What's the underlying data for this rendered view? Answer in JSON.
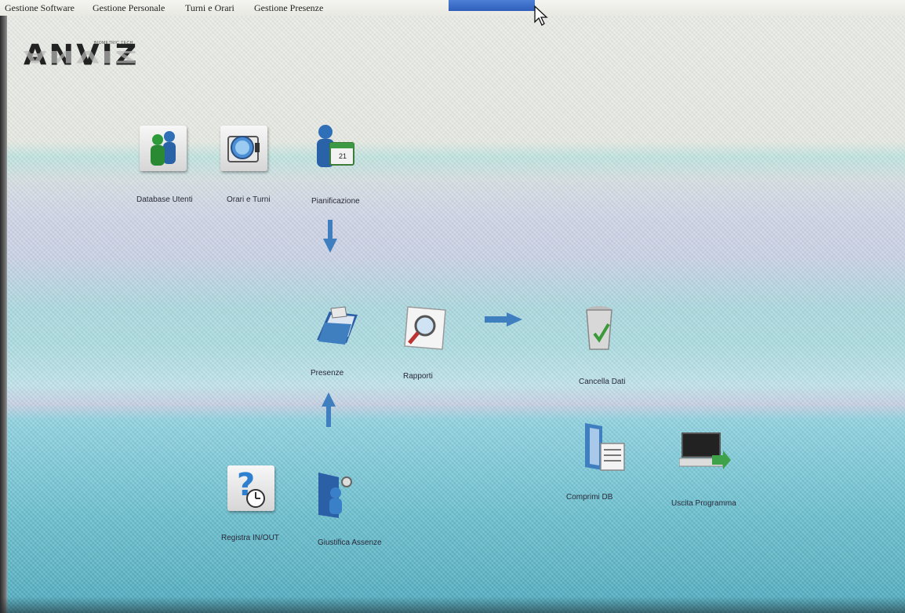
{
  "menu": {
    "items": [
      {
        "label": "Gestione Software"
      },
      {
        "label": "Gestione Personale"
      },
      {
        "label": "Turni e Orari"
      },
      {
        "label": "Gestione Presenze"
      }
    ]
  },
  "logo": {
    "text": "ANVIZ",
    "tagline": "BIOMETRIC TECH"
  },
  "icons": {
    "database_utenti": {
      "label": "Database Utenti",
      "icon": "users-icon"
    },
    "orari_turni": {
      "label": "Orari e Turni",
      "icon": "clock-icon"
    },
    "pianificazione": {
      "label": "Pianificazione",
      "icon": "calendar-user-icon",
      "calendar_day": "21"
    },
    "presenze": {
      "label": "Presenze",
      "icon": "folder-icon"
    },
    "rapporti": {
      "label": "Rapporti",
      "icon": "report-magnifier-icon"
    },
    "cancella_dati": {
      "label": "Cancella Dati",
      "icon": "trash-icon"
    },
    "comprimi_db": {
      "label": "Comprimi DB",
      "icon": "compress-db-icon"
    },
    "uscita_programma": {
      "label": "Uscita Programma",
      "icon": "exit-computer-icon"
    },
    "registra_inout": {
      "label": "Registra IN/OUT",
      "icon": "question-clock-icon"
    },
    "giustifica_assenze": {
      "label": "Giustifica Assenze",
      "icon": "user-door-icon"
    }
  },
  "colors": {
    "menu_highlight": "#3a68c4",
    "arrow_blue": "#3f7fc0"
  }
}
